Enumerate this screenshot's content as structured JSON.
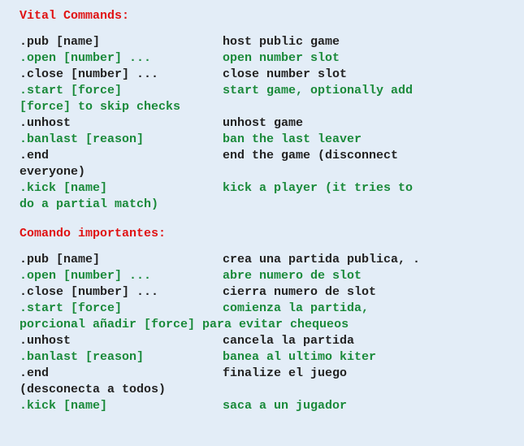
{
  "sections": [
    {
      "title": "Vital Commands:",
      "rows": [
        {
          "cmd": ".pub [name]",
          "cmd_class": "dark",
          "desc": "host public game",
          "desc_class": "dark"
        },
        {
          "cmd": ".open [number] ...",
          "cmd_class": "green",
          "desc": "open number slot",
          "desc_class": "green"
        },
        {
          "cmd": ".close [number] ...",
          "cmd_class": "dark",
          "desc": "close number slot",
          "desc_class": "dark"
        },
        {
          "cmd": ".start [force]",
          "cmd_class": "green",
          "desc": "start game, optionally add ",
          "desc_class": "green",
          "cont": "[force] to skip checks",
          "cont_class": "green"
        },
        {
          "cmd": ".unhost",
          "cmd_class": "dark",
          "desc": "unhost game",
          "desc_class": "dark"
        },
        {
          "cmd": ".banlast [reason]",
          "cmd_class": "green",
          "desc": "ban the last leaver",
          "desc_class": "green"
        },
        {
          "cmd": ".end",
          "cmd_class": "dark",
          "desc": "end the game (disconnect ",
          "desc_class": "dark",
          "cont": "everyone)",
          "cont_class": "dark"
        },
        {
          "cmd": ".kick [name]",
          "cmd_class": "green",
          "desc": "kick a player (it tries to ",
          "desc_class": "green",
          "cont": "do a partial match)",
          "cont_class": "green"
        }
      ]
    },
    {
      "title": "Comando importantes:",
      "rows": [
        {
          "cmd": ".pub [name]",
          "cmd_class": "dark",
          "desc": "crea una partida publica, .",
          "desc_class": "dark"
        },
        {
          "cmd": ".open [number] ...",
          "cmd_class": "green",
          "desc": "abre numero de slot",
          "desc_class": "green"
        },
        {
          "cmd": ".close [number] ...",
          "cmd_class": "dark",
          "desc": "cierra numero de slot",
          "desc_class": "dark"
        },
        {
          "cmd": ".start [force]",
          "cmd_class": "green",
          "desc": "comienza la partida, ",
          "desc_class": "green",
          "cont": "porcional añadir [force] para evitar chequeos",
          "cont_class": "green"
        },
        {
          "cmd": ".unhost",
          "cmd_class": "dark",
          "desc": "cancela la partida",
          "desc_class": "dark"
        },
        {
          "cmd": ".banlast [reason]",
          "cmd_class": "green",
          "desc": "banea al ultimo kiter",
          "desc_class": "green"
        },
        {
          "cmd": ".end",
          "cmd_class": "dark",
          "desc": "finalize el juego ",
          "desc_class": "dark",
          "cont": "(desconecta a todos)",
          "cont_class": "dark"
        },
        {
          "cmd": ".kick [name]",
          "cmd_class": "green",
          "desc": "saca a un jugador",
          "desc_class": "green"
        }
      ]
    }
  ]
}
